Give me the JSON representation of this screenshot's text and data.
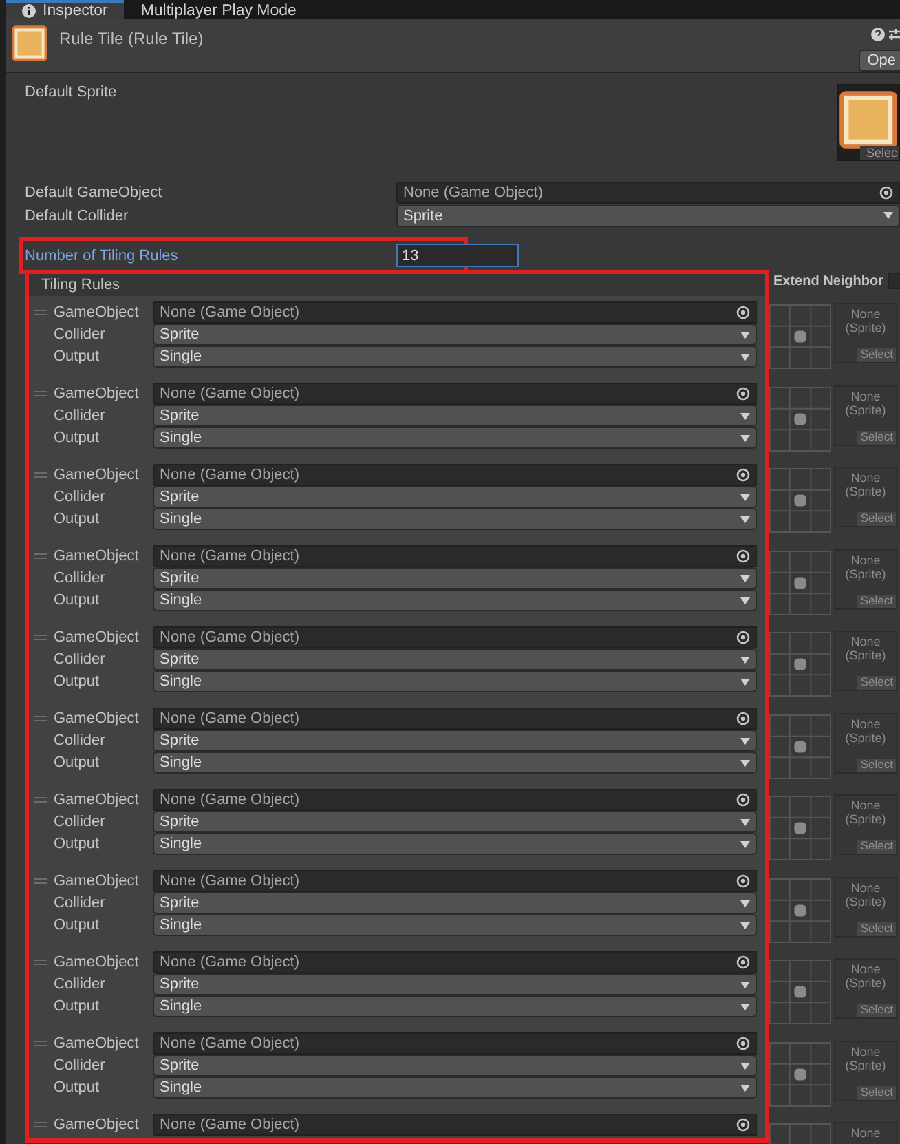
{
  "tabs": [
    {
      "label": "Inspector",
      "selected": true
    },
    {
      "label": "Multiplayer Play Mode",
      "selected": false
    }
  ],
  "header": {
    "title": "Rule Tile (Rule Tile)",
    "button": "Ope"
  },
  "default_sprite": {
    "label": "Default Sprite",
    "button": "Selec"
  },
  "fields": [
    {
      "label": "Default GameObject",
      "kind": "object",
      "value": "None (Game Object)"
    },
    {
      "label": "Default Collider",
      "kind": "dropdown",
      "value": "Sprite"
    }
  ],
  "number_of_tiling_rules": {
    "label": "Number of Tiling Rules",
    "value": "13",
    "highlighted": true
  },
  "tiling_rules": {
    "label": "Tiling Rules",
    "extend_neighbor": "Extend Neighbor",
    "extend_neighbor_checked": false,
    "highlighted": true,
    "rules": [
      {
        "game_object_label": "GameObject",
        "game_object": "None (Game Object)",
        "collider_label": "Collider",
        "collider": "Sprite",
        "output_label": "Output",
        "output": "Single",
        "sprite": "None (Sprite)",
        "select": "Select"
      },
      {
        "game_object_label": "GameObject",
        "game_object": "None (Game Object)",
        "collider_label": "Collider",
        "collider": "Sprite",
        "output_label": "Output",
        "output": "Single",
        "sprite": "None (Sprite)",
        "select": "Select"
      },
      {
        "game_object_label": "GameObject",
        "game_object": "None (Game Object)",
        "collider_label": "Collider",
        "collider": "Sprite",
        "output_label": "Output",
        "output": "Single",
        "sprite": "None (Sprite)",
        "select": "Select"
      },
      {
        "game_object_label": "GameObject",
        "game_object": "None (Game Object)",
        "collider_label": "Collider",
        "collider": "Sprite",
        "output_label": "Output",
        "output": "Single",
        "sprite": "None (Sprite)",
        "select": "Select"
      },
      {
        "game_object_label": "GameObject",
        "game_object": "None (Game Object)",
        "collider_label": "Collider",
        "collider": "Sprite",
        "output_label": "Output",
        "output": "Single",
        "sprite": "None (Sprite)",
        "select": "Select"
      },
      {
        "game_object_label": "GameObject",
        "game_object": "None (Game Object)",
        "collider_label": "Collider",
        "collider": "Sprite",
        "output_label": "Output",
        "output": "Single",
        "sprite": "None (Sprite)",
        "select": "Select"
      },
      {
        "game_object_label": "GameObject",
        "game_object": "None (Game Object)",
        "collider_label": "Collider",
        "collider": "Sprite",
        "output_label": "Output",
        "output": "Single",
        "sprite": "None (Sprite)",
        "select": "Select"
      },
      {
        "game_object_label": "GameObject",
        "game_object": "None (Game Object)",
        "collider_label": "Collider",
        "collider": "Sprite",
        "output_label": "Output",
        "output": "Single",
        "sprite": "None (Sprite)",
        "select": "Select"
      },
      {
        "game_object_label": "GameObject",
        "game_object": "None (Game Object)",
        "collider_label": "Collider",
        "collider": "Sprite",
        "output_label": "Output",
        "output": "Single",
        "sprite": "None (Sprite)",
        "select": "Select"
      },
      {
        "game_object_label": "GameObject",
        "game_object": "None (Game Object)",
        "collider_label": "Collider",
        "collider": "Sprite",
        "output_label": "Output",
        "output": "Single",
        "sprite": "None (Sprite)",
        "select": "Select"
      },
      {
        "game_object_label": "GameObject",
        "game_object": "None (Game Object)",
        "sprite": "None"
      }
    ]
  }
}
